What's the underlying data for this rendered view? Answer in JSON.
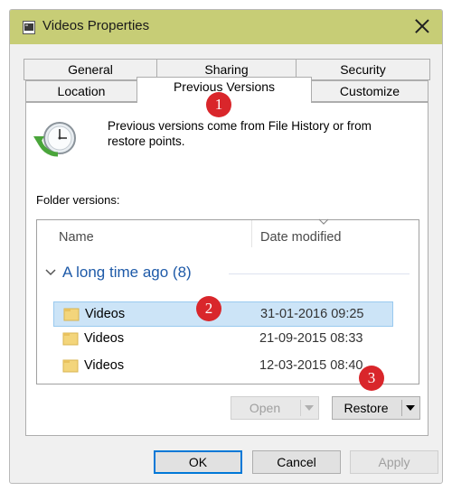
{
  "window": {
    "title": "Videos Properties",
    "titlebar_color": "#c7cd76"
  },
  "tabs": {
    "row1": [
      "General",
      "Sharing",
      "Security"
    ],
    "row2": [
      "Location",
      "Previous Versions",
      "Customize"
    ],
    "active": "Previous Versions"
  },
  "info": {
    "text": "Previous versions come from File History or from restore points."
  },
  "folder_versions": {
    "label": "Folder versions:",
    "columns": [
      "Name",
      "Date modified"
    ],
    "group": "A long time ago (8)",
    "rows": [
      {
        "name": "Videos",
        "date": "31-01-2016 09:25",
        "selected": true
      },
      {
        "name": "Videos",
        "date": "21-09-2015 08:33",
        "selected": false
      },
      {
        "name": "Videos",
        "date": "12-03-2015 08:40",
        "selected": false
      }
    ]
  },
  "actions": {
    "open": "Open",
    "restore": "Restore"
  },
  "footer": {
    "ok": "OK",
    "cancel": "Cancel",
    "apply": "Apply"
  },
  "annotations": [
    "1",
    "2",
    "3"
  ],
  "colors": {
    "accent": "#0078d7",
    "selection": "#cce4f7",
    "badge": "#d9262b",
    "group_text": "#1e5aa8"
  }
}
